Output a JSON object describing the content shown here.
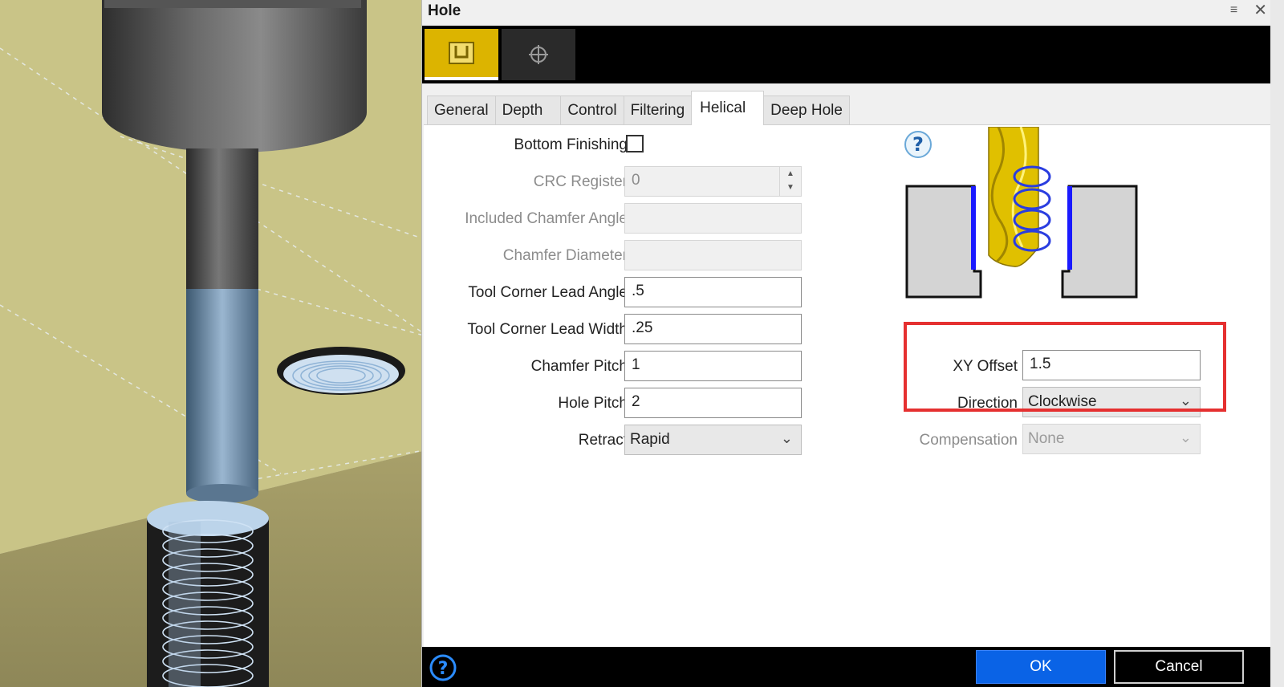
{
  "dialog": {
    "title": "Hole",
    "window_icons": {
      "menu": "≡",
      "close": "✕"
    }
  },
  "toolbar": {
    "buttons": [
      {
        "name": "hole-operation",
        "icon": "u-shape-icon",
        "active": true
      },
      {
        "name": "points",
        "icon": "crosshair-icon",
        "active": false
      }
    ]
  },
  "tabs": [
    {
      "label": "General",
      "active": false
    },
    {
      "label": "Depth",
      "active": false
    },
    {
      "label": "Control",
      "active": false
    },
    {
      "label": "Filtering",
      "active": false
    },
    {
      "label": "Helical",
      "active": true
    },
    {
      "label": "Deep Hole",
      "active": false
    }
  ],
  "helical": {
    "bottom_finishing": {
      "label": "Bottom Finishing",
      "checked": false
    },
    "crc_register": {
      "label": "CRC Register",
      "value": "0",
      "disabled": true
    },
    "included_chamfer_angle": {
      "label": "Included Chamfer Angle",
      "value": "",
      "disabled": true
    },
    "chamfer_diameter": {
      "label": "Chamfer Diameter",
      "value": "",
      "disabled": true
    },
    "tool_corner_lead_angle": {
      "label": "Tool Corner Lead Angle",
      "value": ".5"
    },
    "tool_corner_lead_width": {
      "label": "Tool Corner Lead Width",
      "value": ".25"
    },
    "chamfer_pitch": {
      "label": "Chamfer Pitch",
      "value": "1"
    },
    "hole_pitch": {
      "label": "Hole Pitch",
      "value": "2"
    },
    "retract": {
      "label": "Retract",
      "value": "Rapid"
    },
    "xy_offset": {
      "label": "XY Offset",
      "value": "1.5"
    },
    "direction": {
      "label": "Direction",
      "value": "Clockwise"
    },
    "compensation": {
      "label": "Compensation",
      "value": "None",
      "disabled": true
    }
  },
  "footer": {
    "ok_label": "OK",
    "cancel_label": "Cancel"
  },
  "colors": {
    "accent_yellow": "#dcb400",
    "ok_blue": "#0a63e6",
    "highlight_red": "#e53030",
    "helix_blue": "#2a3de0"
  }
}
